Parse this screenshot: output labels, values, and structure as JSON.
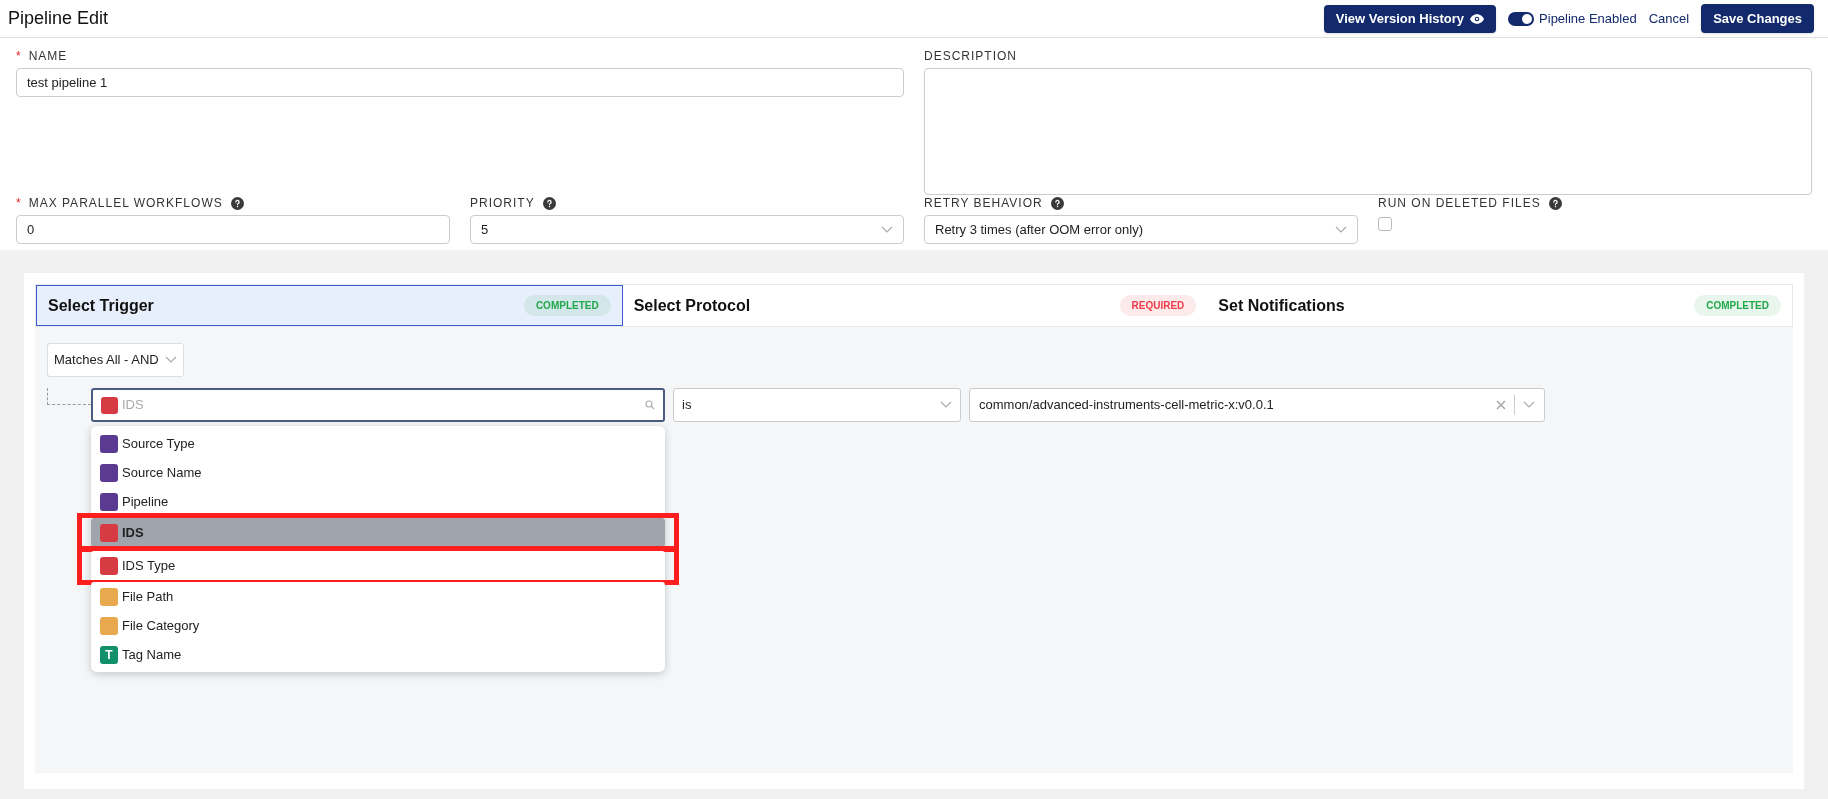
{
  "header": {
    "title": "Pipeline Edit",
    "history_button": "View Version History",
    "toggle": {
      "label": "Pipeline Enabled",
      "on": true
    },
    "cancel": "Cancel",
    "save": "Save Changes"
  },
  "name_field": {
    "label": "NAME",
    "required_mark": "*",
    "value": "test pipeline 1"
  },
  "description_field": {
    "label": "DESCRIPTION"
  },
  "settings": [
    {
      "kind": "input",
      "label": "MAX PARALLEL WORKFLOWS",
      "required_mark": "*",
      "help": true,
      "value": "0"
    },
    {
      "kind": "select",
      "label": "PRIORITY",
      "help": true,
      "value": "5"
    },
    {
      "kind": "select",
      "label": "RETRY BEHAVIOR",
      "help": true,
      "value": "Retry 3 times (after OOM error only)"
    },
    {
      "kind": "checkbox",
      "label": "RUN ON DELETED FILES",
      "help": true,
      "checked": false
    }
  ],
  "tabs": [
    {
      "label": "Select Trigger",
      "status": "COMPLETED",
      "color": "#21a84a",
      "selected": true
    },
    {
      "label": "Select Protocol",
      "status": "REQUIRED",
      "color": "#ef3b47",
      "selected": false
    },
    {
      "label": "Set Notifications",
      "status": "COMPLETED",
      "color": "#21a84a",
      "selected": false
    }
  ],
  "trigger": {
    "match": "Matches All - AND",
    "condition": {
      "field": {
        "placeholder": "IDS",
        "color": "#d63a42"
      },
      "operator": "is",
      "value": "common/advanced-instruments-cell-metric-x:v0.0.1"
    },
    "menu": [
      {
        "label": "Source Type",
        "kind": "swatch",
        "color": "#5b3a92",
        "selected": false,
        "annotated": false
      },
      {
        "label": "Source Name",
        "kind": "swatch",
        "color": "#5b3a92",
        "selected": false,
        "annotated": false
      },
      {
        "label": "Pipeline",
        "kind": "swatch",
        "color": "#5b3a92",
        "selected": false,
        "annotated": false
      },
      {
        "label": "IDS",
        "kind": "swatch",
        "color": "#d63a42",
        "selected": true,
        "annotated": true
      },
      {
        "label": "IDS Type",
        "kind": "swatch",
        "color": "#d63a42",
        "selected": false,
        "annotated": true
      },
      {
        "label": "File Path",
        "kind": "swatch",
        "color": "#e8a94e",
        "selected": false,
        "annotated": false
      },
      {
        "label": "File Category",
        "kind": "swatch",
        "color": "#e8a94e",
        "selected": false,
        "annotated": false
      },
      {
        "label": "Tag Name",
        "kind": "letter",
        "glyph": "T",
        "color": "#12906a",
        "selected": false,
        "annotated": false
      }
    ]
  }
}
